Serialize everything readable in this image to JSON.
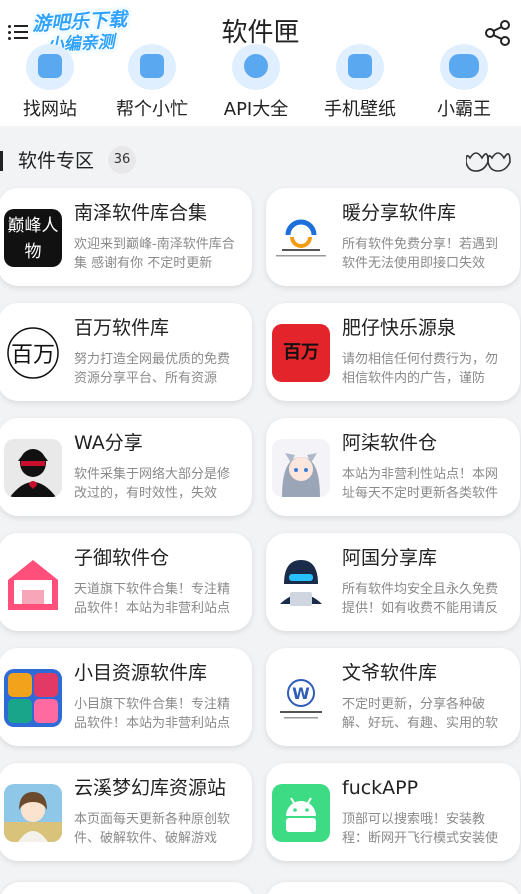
{
  "header": {
    "title": "软件匣",
    "watermark_line1": "游吧乐下载",
    "watermark_line2": "小编亲测",
    "menu_icon": "menu-icon",
    "share_icon": "share-icon"
  },
  "quick_links": [
    {
      "label": "找网站",
      "icon": "globe-icon"
    },
    {
      "label": "帮个小忙",
      "icon": "help-icon"
    },
    {
      "label": "API大全",
      "icon": "api-icon"
    },
    {
      "label": "手机壁纸",
      "icon": "wallpaper-icon"
    },
    {
      "label": "小霸王",
      "icon": "gamepad-icon"
    }
  ],
  "section": {
    "title": "软件专区",
    "count": "36",
    "icon": "flower-icon"
  },
  "cards": [
    {
      "name": "南泽软件库合集",
      "desc": "欢迎来到巅峰-南泽软件库合集 感谢有你 不定时更新",
      "icon_text": "巅峰人物",
      "accent": "#111111"
    },
    {
      "name": "暖分享软件库",
      "desc": "所有软件免费分享！若遇到软件无法使用即接口失效",
      "icon_text": "",
      "accent": "#1e6fd9"
    },
    {
      "name": "百万软件库",
      "desc": "努力打造全网最优质的免费资源分享平台、所有资源",
      "icon_text": "百万",
      "accent": "#111111"
    },
    {
      "name": "肥仔快乐源泉",
      "desc": "请勿相信任何付费行为，勿相信软件内的广告，谨防",
      "icon_text": "百万",
      "accent": "#e3242b"
    },
    {
      "name": "WA分享",
      "desc": "软件采集于网络大部分是修改过的，有时效性，失效",
      "icon_text": "",
      "accent": "#c8102e"
    },
    {
      "name": "阿柒软件仓",
      "desc": "本站为非营利性站点！本网址每天不定时更新各类软件",
      "icon_text": "",
      "accent": "#9aa6b8"
    },
    {
      "name": "子御软件仓",
      "desc": "天道旗下软件合集！专注精品软件！本站为非营利站点",
      "icon_text": "",
      "accent": "#ff4f7a"
    },
    {
      "name": "阿国分享库",
      "desc": "所有软件均安全且永久免费提供！如有收费不能用请反馈",
      "icon_text": "",
      "accent": "#1b2b4a"
    },
    {
      "name": "小目资源软件库",
      "desc": "小目旗下软件合集！专注精品软件！本站为非营利站点",
      "icon_text": "",
      "accent": "#f3a21b"
    },
    {
      "name": "文爷软件库",
      "desc": "不定时更新，分享各种破解、好玩、有趣、实用的软件",
      "icon_text": "W",
      "accent": "#2f5db8"
    },
    {
      "name": "云溪梦幻库资源站",
      "desc": "本页面每天更新各种原创软件、破解软件、破解游戏",
      "icon_text": "",
      "accent": "#8fc7e8"
    },
    {
      "name": "fuckAPP",
      "desc": "顶部可以搜索哦！安装教程：断网开飞行模式安装使用",
      "icon_text": "",
      "accent": "#3ddc84"
    }
  ]
}
